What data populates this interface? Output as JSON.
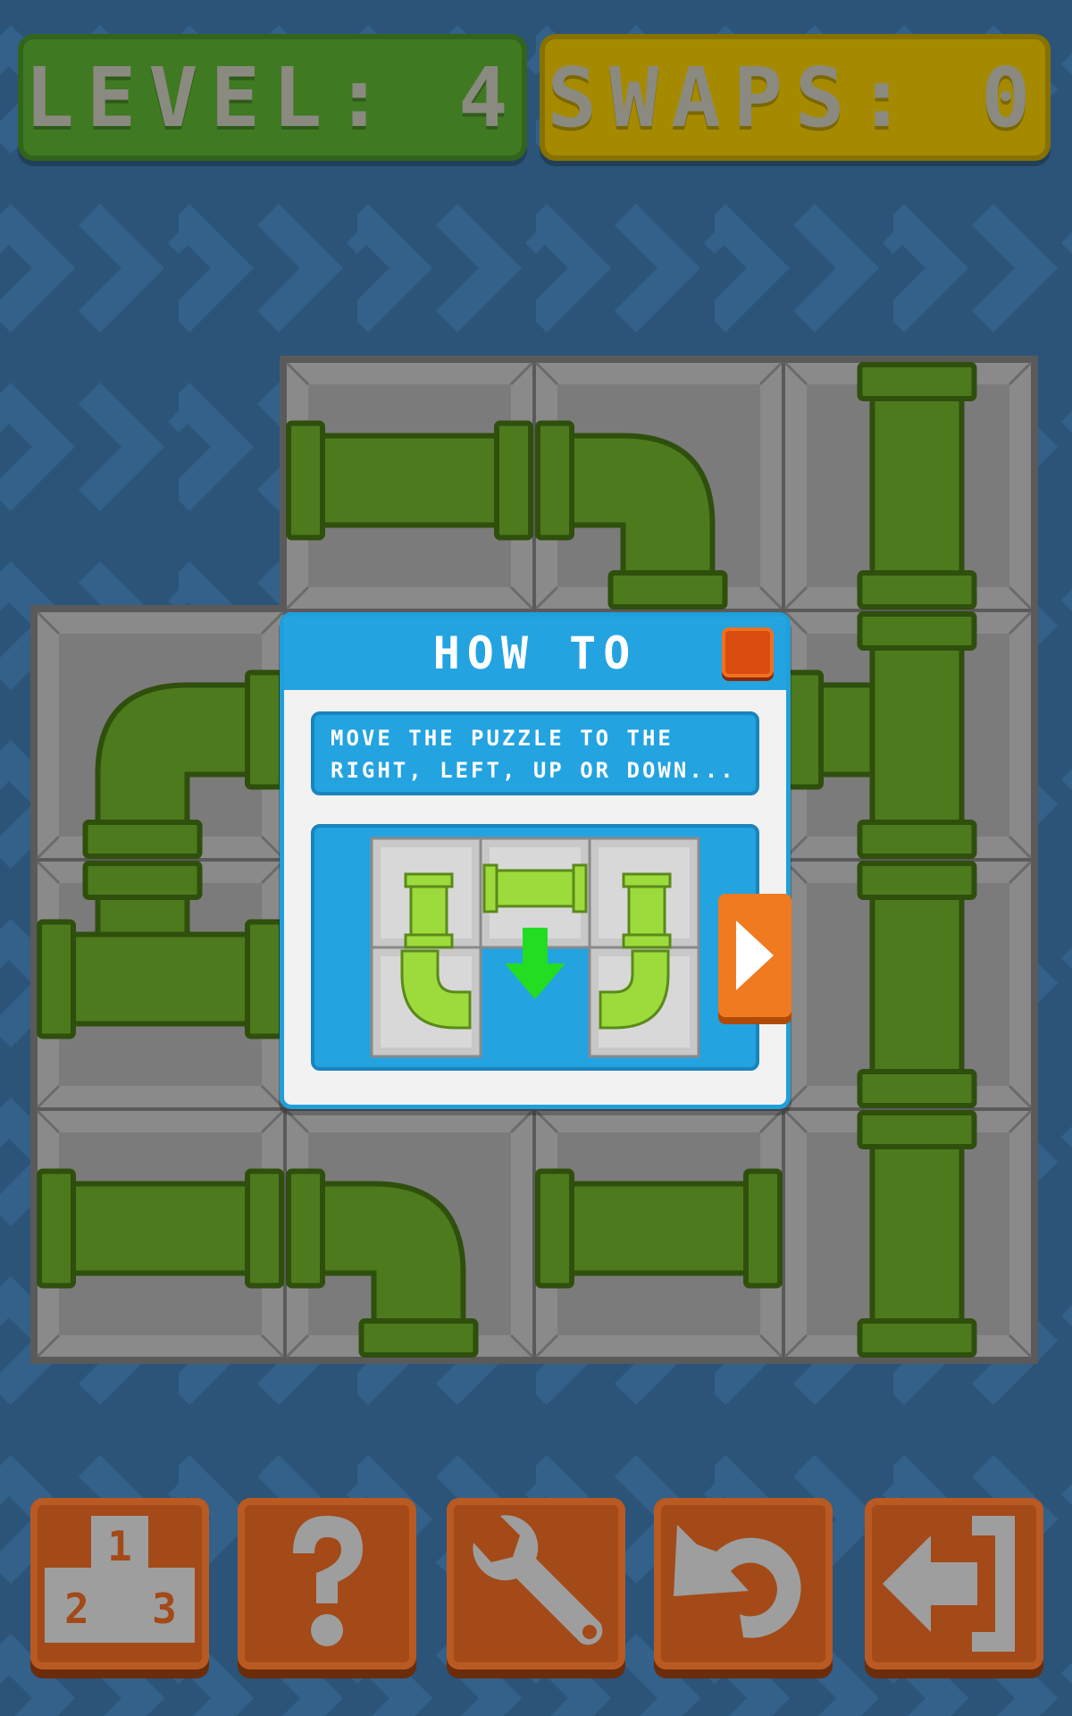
{
  "hud": {
    "level_text": "LEVEL: 4",
    "swaps_text": "SWAPS: 0",
    "level_color": "#3f7a22",
    "swaps_color": "#a58a00"
  },
  "board": {
    "tile_color": "#7b7b7b",
    "pipe_color": "#4e7a1e",
    "pipe_outline": "#2f4f0c",
    "tiles": [
      {
        "row": 0,
        "col": 1,
        "pipe": "straight-horizontal"
      },
      {
        "row": 0,
        "col": 2,
        "pipe": "elbow-left-down"
      },
      {
        "row": 0,
        "col": 3,
        "pipe": "straight-vertical"
      },
      {
        "row": 1,
        "col": 0,
        "pipe": "elbow-right-down"
      },
      {
        "row": 1,
        "col": 3,
        "pipe": "tee-up-down-left"
      },
      {
        "row": 2,
        "col": 0,
        "pipe": "tee-left-right-up"
      },
      {
        "row": 2,
        "col": 3,
        "pipe": "straight-vertical"
      },
      {
        "row": 3,
        "col": 0,
        "pipe": "straight-horizontal"
      },
      {
        "row": 3,
        "col": 1,
        "pipe": "elbow-left-down"
      },
      {
        "row": 3,
        "col": 2,
        "pipe": "straight-horizontal"
      },
      {
        "row": 3,
        "col": 3,
        "pipe": "straight-vertical"
      }
    ]
  },
  "modal": {
    "title": "HOW TO",
    "line1": "MOVE THE PUZZLE TO THE",
    "line2": "RIGHT, LEFT, UP OR DOWN...",
    "close_icon": "close-icon",
    "next_icon": "play-arrow-icon",
    "demo_pipe_color": "#9ddb3c",
    "demo_arrow_color": "#22dd22"
  },
  "toolbar": {
    "buttons": [
      {
        "name": "leaderboard-button",
        "icon": "podium-icon",
        "labels": [
          "1",
          "2",
          "3"
        ]
      },
      {
        "name": "help-button",
        "icon": "question-icon"
      },
      {
        "name": "settings-button",
        "icon": "wrench-icon"
      },
      {
        "name": "undo-button",
        "icon": "undo-icon"
      },
      {
        "name": "exit-button",
        "icon": "exit-icon"
      }
    ],
    "button_color": "#a34a18",
    "icon_color": "#9e9e9e"
  }
}
